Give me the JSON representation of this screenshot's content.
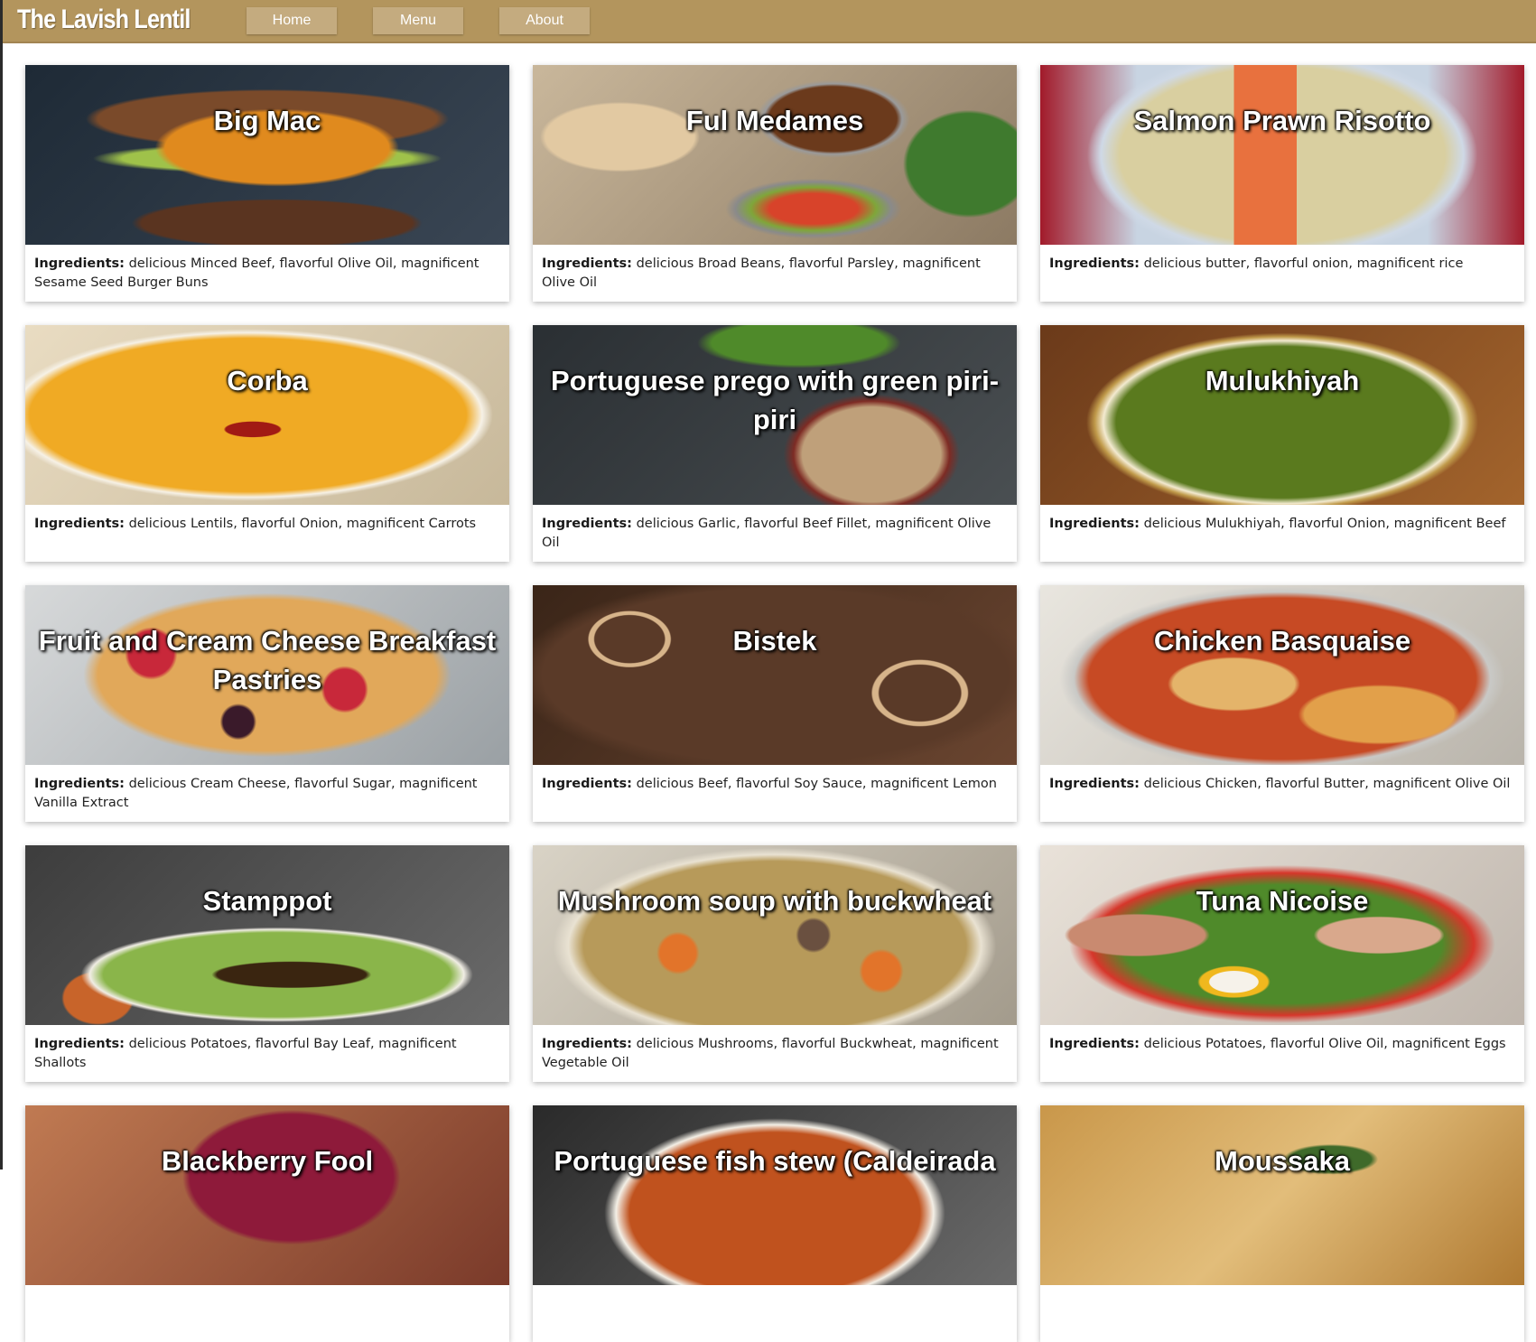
{
  "brand": {
    "name": "The Lavish Lentil"
  },
  "nav": {
    "items": [
      {
        "label": "Home"
      },
      {
        "label": "Menu"
      },
      {
        "label": "About"
      }
    ]
  },
  "colors": {
    "navbar": "#b3955d",
    "nav_button": "#c4ab7f"
  },
  "ingredients_label": "Ingredients:",
  "recipes": [
    {
      "title": "Big Mac",
      "ingredients": "delicious Minced Beef, flavorful Olive Oil, magnificent Sesame Seed Burger Buns",
      "photo": "burger-photo"
    },
    {
      "title": "Ful Medames",
      "ingredients": "delicious Broad Beans, flavorful Parsley, magnificent Olive Oil",
      "photo": "bean-stew-photo"
    },
    {
      "title": "Salmon Prawn Risotto",
      "ingredients": "delicious butter, flavorful onion, magnificent rice",
      "photo": "risotto-photo"
    },
    {
      "title": "Corba",
      "ingredients": "delicious Lentils, flavorful Onion, magnificent Carrots",
      "photo": "soup-photo"
    },
    {
      "title": "Portuguese prego with green piri-piri",
      "ingredients": "delicious Garlic, flavorful Beef Fillet, magnificent Olive Oil",
      "photo": "steak-sandwich-photo"
    },
    {
      "title": "Mulukhiyah",
      "ingredients": "delicious Mulukhiyah, flavorful Onion, magnificent Beef",
      "photo": "green-stew-photo"
    },
    {
      "title": "Fruit and Cream Cheese Breakfast Pastries",
      "ingredients": "delicious Cream Cheese, flavorful Sugar, magnificent Vanilla Extract",
      "photo": "pastries-photo"
    },
    {
      "title": "Bistek",
      "ingredients": "delicious Beef, flavorful Soy Sauce, magnificent Lemon",
      "photo": "beef-onion-photo"
    },
    {
      "title": "Chicken Basquaise",
      "ingredients": "delicious Chicken, flavorful Butter, magnificent Olive Oil",
      "photo": "chicken-rice-photo"
    },
    {
      "title": "Stamppot",
      "ingredients": "delicious Potatoes, flavorful Bay Leaf, magnificent Shallots",
      "photo": "mash-sausage-photo"
    },
    {
      "title": "Mushroom soup with buckwheat",
      "ingredients": "delicious Mushrooms, flavorful Buckwheat, magnificent Vegetable Oil",
      "photo": "mushroom-soup-photo"
    },
    {
      "title": "Tuna Nicoise",
      "ingredients": "delicious Potatoes, flavorful Olive Oil, magnificent Eggs",
      "photo": "salad-photo"
    },
    {
      "title": "Blackberry Fool",
      "ingredients": "",
      "photo": "berry-dessert-photo"
    },
    {
      "title": "Portuguese fish stew (Caldeirada",
      "ingredients": "",
      "photo": "fish-stew-photo"
    },
    {
      "title": "Moussaka",
      "ingredients": "",
      "photo": "moussaka-photo"
    }
  ]
}
